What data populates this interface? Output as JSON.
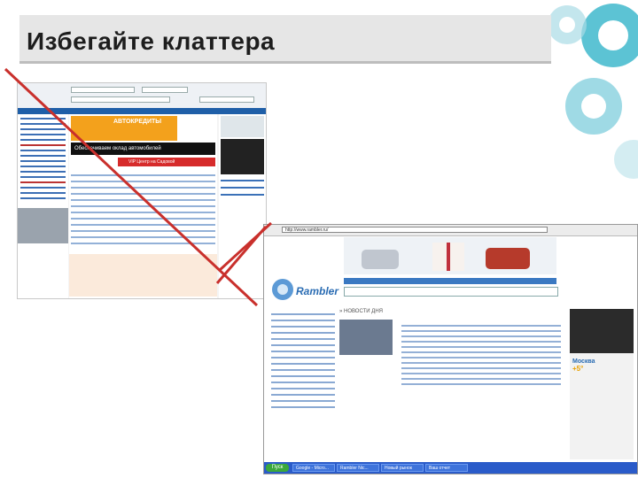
{
  "slide": {
    "title": "Избегайте клаттера"
  },
  "colors": {
    "accent_teal": "#28b6c9",
    "strike_red": "#c9302c",
    "title_bg": "#e6e6e6"
  },
  "shot1": {
    "banner_credit": "АВТОКРЕДИТЫ",
    "banner_text": "Обеспечиваем оклад автомобилей",
    "banner_vip": "VIP Центр на Садовой"
  },
  "shot2": {
    "url": "http://www.rambler.ru/",
    "logo": "Rambler",
    "news_header": "» НОВОСТИ ДНЯ",
    "city": "Москва",
    "temperature": "+5°",
    "taskbar": {
      "start": "Пуск",
      "items": [
        "Google - Micro...",
        "Rambler Nic...",
        "Новый рынок",
        "Ваш отчет"
      ]
    }
  }
}
